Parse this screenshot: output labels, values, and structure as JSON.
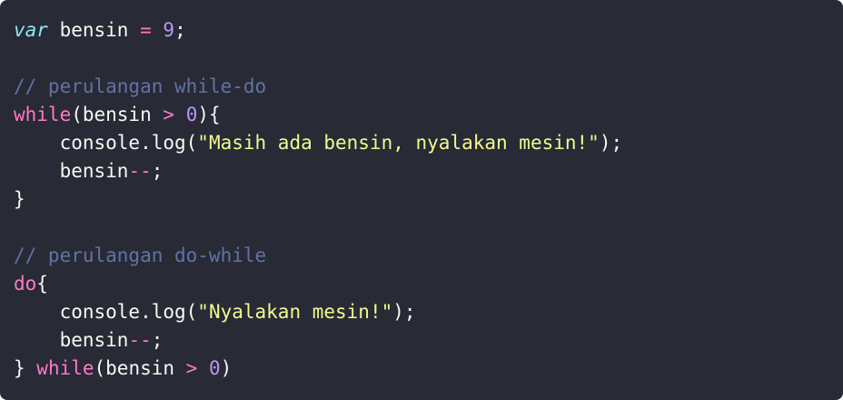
{
  "editor": {
    "background": "#282a36",
    "colors": {
      "storage": "#8be9fd",
      "plain": "#f8f8f2",
      "operator": "#ff79c6",
      "number": "#bd93f9",
      "comment": "#6272a4",
      "keyword": "#ff79c6",
      "string": "#f1fa8c"
    },
    "lines": [
      [
        {
          "t": "storage",
          "v": "var"
        },
        {
          "t": "plain",
          "v": " bensin "
        },
        {
          "t": "op",
          "v": "="
        },
        {
          "t": "plain",
          "v": " "
        },
        {
          "t": "num",
          "v": "9"
        },
        {
          "t": "plain",
          "v": ";"
        }
      ],
      [],
      [
        {
          "t": "comment",
          "v": "// perulangan while-do"
        }
      ],
      [
        {
          "t": "keyword",
          "v": "while"
        },
        {
          "t": "plain",
          "v": "(bensin "
        },
        {
          "t": "op",
          "v": ">"
        },
        {
          "t": "plain",
          "v": " "
        },
        {
          "t": "num",
          "v": "0"
        },
        {
          "t": "plain",
          "v": "){"
        }
      ],
      [
        {
          "t": "plain",
          "v": "    console.log("
        },
        {
          "t": "string",
          "v": "\"Masih ada bensin, nyalakan mesin!\""
        },
        {
          "t": "plain",
          "v": ");"
        }
      ],
      [
        {
          "t": "plain",
          "v": "    bensin"
        },
        {
          "t": "op",
          "v": "--"
        },
        {
          "t": "plain",
          "v": ";"
        }
      ],
      [
        {
          "t": "plain",
          "v": "}"
        }
      ],
      [],
      [
        {
          "t": "comment",
          "v": "// perulangan do-while"
        }
      ],
      [
        {
          "t": "keyword",
          "v": "do"
        },
        {
          "t": "plain",
          "v": "{"
        }
      ],
      [
        {
          "t": "plain",
          "v": "    console.log("
        },
        {
          "t": "string",
          "v": "\"Nyalakan mesin!\""
        },
        {
          "t": "plain",
          "v": ");"
        }
      ],
      [
        {
          "t": "plain",
          "v": "    bensin"
        },
        {
          "t": "op",
          "v": "--"
        },
        {
          "t": "plain",
          "v": ";"
        }
      ],
      [
        {
          "t": "plain",
          "v": "} "
        },
        {
          "t": "keyword",
          "v": "while"
        },
        {
          "t": "plain",
          "v": "(bensin "
        },
        {
          "t": "op",
          "v": ">"
        },
        {
          "t": "plain",
          "v": " "
        },
        {
          "t": "num",
          "v": "0"
        },
        {
          "t": "plain",
          "v": ")"
        }
      ]
    ]
  }
}
